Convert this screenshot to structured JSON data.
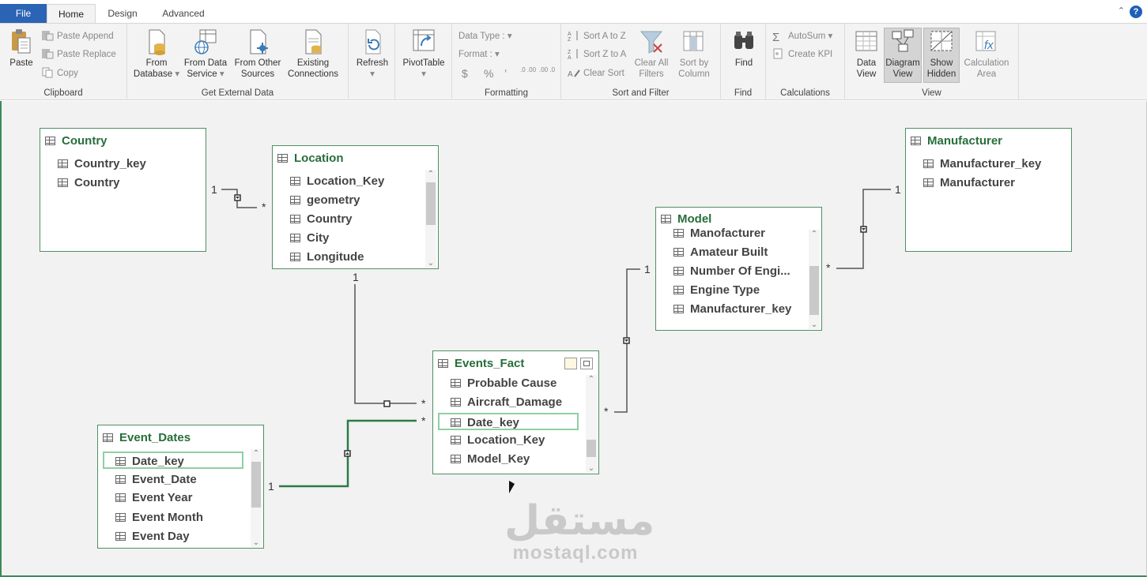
{
  "tabs": {
    "file": "File",
    "home": "Home",
    "design": "Design",
    "advanced": "Advanced"
  },
  "help": "?",
  "ribbon": {
    "clipboard": {
      "label": "Clipboard",
      "paste": "Paste",
      "paste_append": "Paste Append",
      "paste_replace": "Paste Replace",
      "copy": "Copy"
    },
    "external": {
      "label": "Get External Data",
      "from_database": [
        "From",
        "Database"
      ],
      "from_data_service": [
        "From Data",
        "Service"
      ],
      "from_other_sources": [
        "From Other",
        "Sources"
      ],
      "existing_connections": [
        "Existing",
        "Connections"
      ]
    },
    "refresh": {
      "label": "Refresh"
    },
    "pivot": {
      "label": "PivotTable"
    },
    "formatting": {
      "label": "Formatting",
      "data_type": "Data Type :",
      "format": "Format :",
      "currency": "$",
      "percent": "%",
      "comma": "’",
      "inc_dec": ".0 .00",
      "dec_dec": ".00 .0"
    },
    "sort": {
      "label": "Sort and Filter",
      "a_to_z": "Sort A to Z",
      "z_to_a": "Sort Z to A",
      "clear_sort": "Clear Sort",
      "clear_filters": [
        "Clear All",
        "Filters"
      ],
      "sort_by_column": [
        "Sort by",
        "Column"
      ]
    },
    "find": {
      "label": "Find",
      "button": "Find"
    },
    "calculations": {
      "label": "Calculations",
      "autosum": "AutoSum",
      "create_kpi": "Create KPI"
    },
    "view": {
      "label": "View",
      "data_view": [
        "Data",
        "View"
      ],
      "diagram_view": [
        "Diagram",
        "View"
      ],
      "show_hidden": [
        "Show",
        "Hidden"
      ],
      "calculation_area": [
        "Calculation",
        "Area"
      ]
    }
  },
  "tables": {
    "country": {
      "title": "Country",
      "columns": [
        "Country_key",
        "Country"
      ]
    },
    "location": {
      "title": "Location",
      "columns": [
        "Location_Key",
        "geometry",
        "Country",
        "City",
        "Longitude"
      ]
    },
    "manufacturer": {
      "title": "Manufacturer",
      "columns": [
        "Manufacturer_key",
        "Manufacturer"
      ]
    },
    "model": {
      "title": "Model",
      "columns": [
        "Manofacturer",
        "Amateur Built",
        "Number Of Engi...",
        "Engine Type",
        "Manufacturer_key"
      ]
    },
    "events_fact": {
      "title": "Events_Fact",
      "columns": [
        "Probable Cause",
        "Aircraft_Damage",
        "Date_key",
        "Location_Key",
        "Model_Key"
      ]
    },
    "event_dates": {
      "title": "Event_Dates",
      "columns": [
        "Date_key",
        "Event_Date",
        "Event Year",
        "Event Month",
        "Event Day"
      ]
    }
  },
  "cardinality": {
    "one": "1",
    "many": "*"
  },
  "watermark": {
    "arabic": "مستقل",
    "latin": "mostaql.com"
  }
}
